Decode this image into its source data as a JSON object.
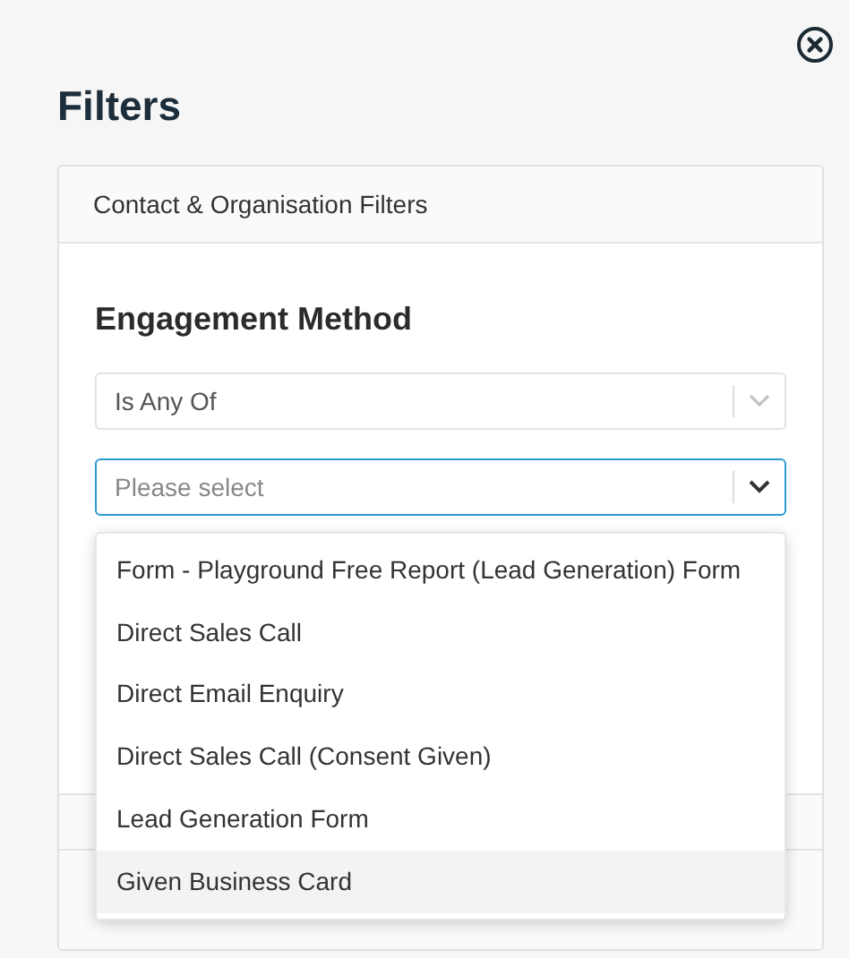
{
  "title": "Filters",
  "sections": [
    {
      "label": "Contact & Organisation Filters",
      "expanded": true
    }
  ],
  "field": {
    "label": "Engagement Method"
  },
  "operator_select": {
    "value": "Is Any Of",
    "focused": false
  },
  "value_select": {
    "placeholder": "Please select",
    "focused": true
  },
  "options": [
    {
      "label": "Form - Playground Free Report (Lead Generation) Form",
      "selected": false
    },
    {
      "label": "Direct Sales Call",
      "selected": false
    },
    {
      "label": "Direct Email Enquiry",
      "selected": false
    },
    {
      "label": "Direct Sales Call (Consent Given)",
      "selected": false
    },
    {
      "label": "Lead Generation Form",
      "selected": false
    },
    {
      "label": "Given Business Card",
      "selected": true
    }
  ]
}
